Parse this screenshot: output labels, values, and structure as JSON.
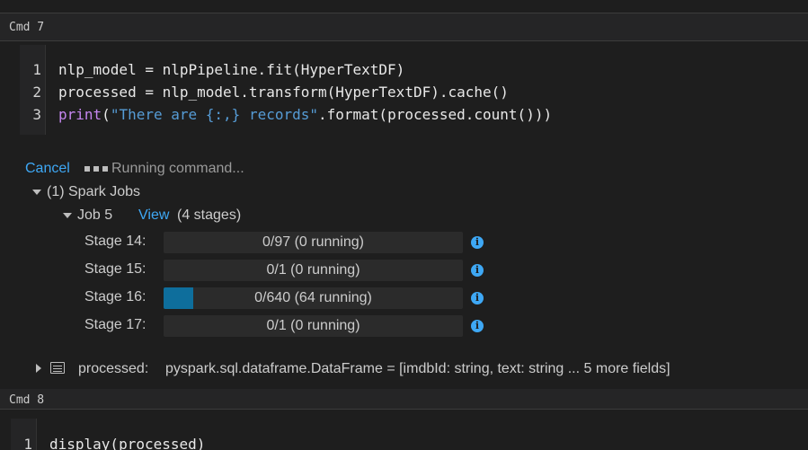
{
  "cells": [
    {
      "cmd_label": "Cmd 7",
      "code_lines": [
        {
          "num": "1",
          "segments": [
            {
              "text": "nlp_model = nlpPipeline.fit(HyperTextDF)"
            }
          ]
        },
        {
          "num": "2",
          "segments": [
            {
              "text": "processed = nlp_model.transform(HyperTextDF).cache()"
            }
          ]
        },
        {
          "num": "3",
          "segments": [
            {
              "text": "print",
              "cls": "kw"
            },
            {
              "text": "("
            },
            {
              "text": "\"There are {:,} records\"",
              "cls": "str"
            },
            {
              "text": ".format(processed.count()))"
            }
          ]
        }
      ]
    },
    {
      "cmd_label": "Cmd 8",
      "code_lines": [
        {
          "num": "1",
          "segments": [
            {
              "text": "display(processed)"
            }
          ]
        }
      ]
    }
  ],
  "run_status": {
    "cancel_label": "Cancel",
    "status_text": "Running command..."
  },
  "spark_jobs": {
    "header": "(1) Spark Jobs",
    "job_label": "Job 5",
    "view_label": "View",
    "stages_summary": "(4 stages)"
  },
  "stages": [
    {
      "label": "Stage 14:",
      "progress_text": "0/97 (0 running)",
      "running_fraction": 0.0
    },
    {
      "label": "Stage 15:",
      "progress_text": "0/1 (0 running)",
      "running_fraction": 0.0
    },
    {
      "label": "Stage 16:",
      "progress_text": "0/640 (64 running)",
      "running_fraction": 0.1
    },
    {
      "label": "Stage 17:",
      "progress_text": "0/1 (0 running)",
      "running_fraction": 0.0
    }
  ],
  "dataframe": {
    "name": "processed:",
    "type_text": "pyspark.sql.dataframe.DataFrame = [imdbId: string, text: string ... 5 more fields]"
  },
  "icons": {
    "info": "info-icon",
    "table": "table-icon",
    "expand": "caret-icon"
  },
  "colors": {
    "accent": "#3ea8f5",
    "progress": "#0e6e9c",
    "keyword": "#c586f0",
    "string": "#569cd6"
  }
}
